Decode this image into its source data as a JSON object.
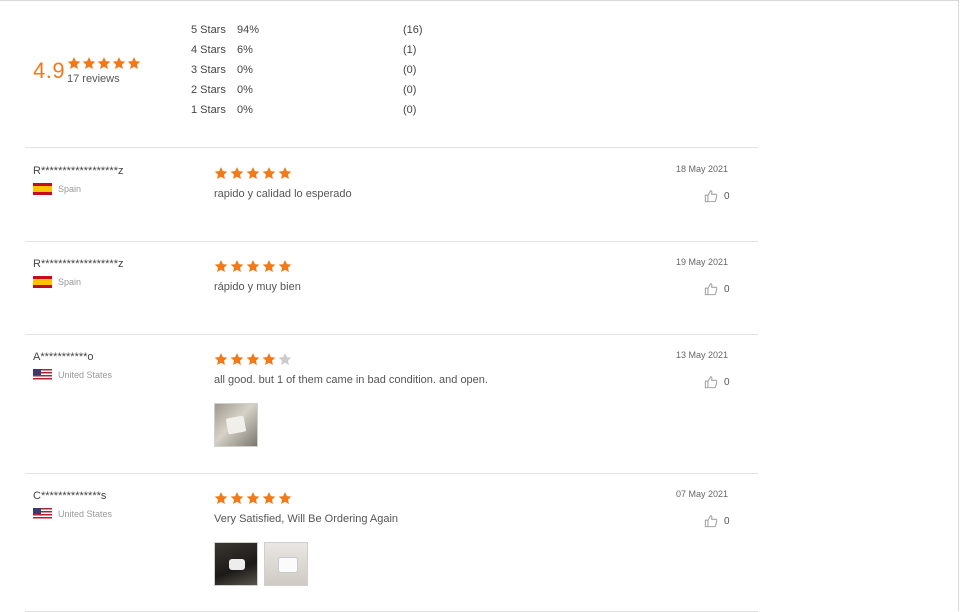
{
  "summary": {
    "average": "4.9",
    "rating_stars": 5,
    "review_count_text": "17 reviews",
    "distribution": [
      {
        "label": "5 Stars",
        "percent": "94%",
        "count": "(16)"
      },
      {
        "label": "4 Stars",
        "percent": "6%",
        "count": "(1)"
      },
      {
        "label": "3 Stars",
        "percent": "0%",
        "count": "(0)"
      },
      {
        "label": "2 Stars",
        "percent": "0%",
        "count": "(0)"
      },
      {
        "label": "1 Stars",
        "percent": "0%",
        "count": "(0)"
      }
    ]
  },
  "colors": {
    "accent": "#f07a1b",
    "star_empty": "#cccccc",
    "divider": "#e3e3e3"
  },
  "icons": {
    "star": "star-icon",
    "thumbs_up": "thumbs-up-icon"
  },
  "reviews": [
    {
      "reviewer": "R******************z",
      "country": "Spain",
      "flag": "es",
      "rating": 5,
      "comment": "rapido y calidad  lo esperado",
      "date": "18 May 2021",
      "helpful_count": "0",
      "photos": []
    },
    {
      "reviewer": "R******************z",
      "country": "Spain",
      "flag": "es",
      "rating": 5,
      "comment": "rápido  y muy bien",
      "date": "19 May 2021",
      "helpful_count": "0",
      "photos": []
    },
    {
      "reviewer": "A***********o",
      "country": "United States",
      "flag": "us",
      "rating": 4,
      "comment": "all good. but 1 of them came in bad condition. and open.",
      "date": "13 May 2021",
      "helpful_count": "0",
      "photos": [
        "photo-thumbnail"
      ]
    },
    {
      "reviewer": "C**************s",
      "country": "United States",
      "flag": "us",
      "rating": 5,
      "comment": "Very Satisfied, Will Be Ordering Again",
      "date": "07 May 2021",
      "helpful_count": "0",
      "photos": [
        "photo-thumbnail",
        "photo-thumbnail"
      ]
    }
  ]
}
